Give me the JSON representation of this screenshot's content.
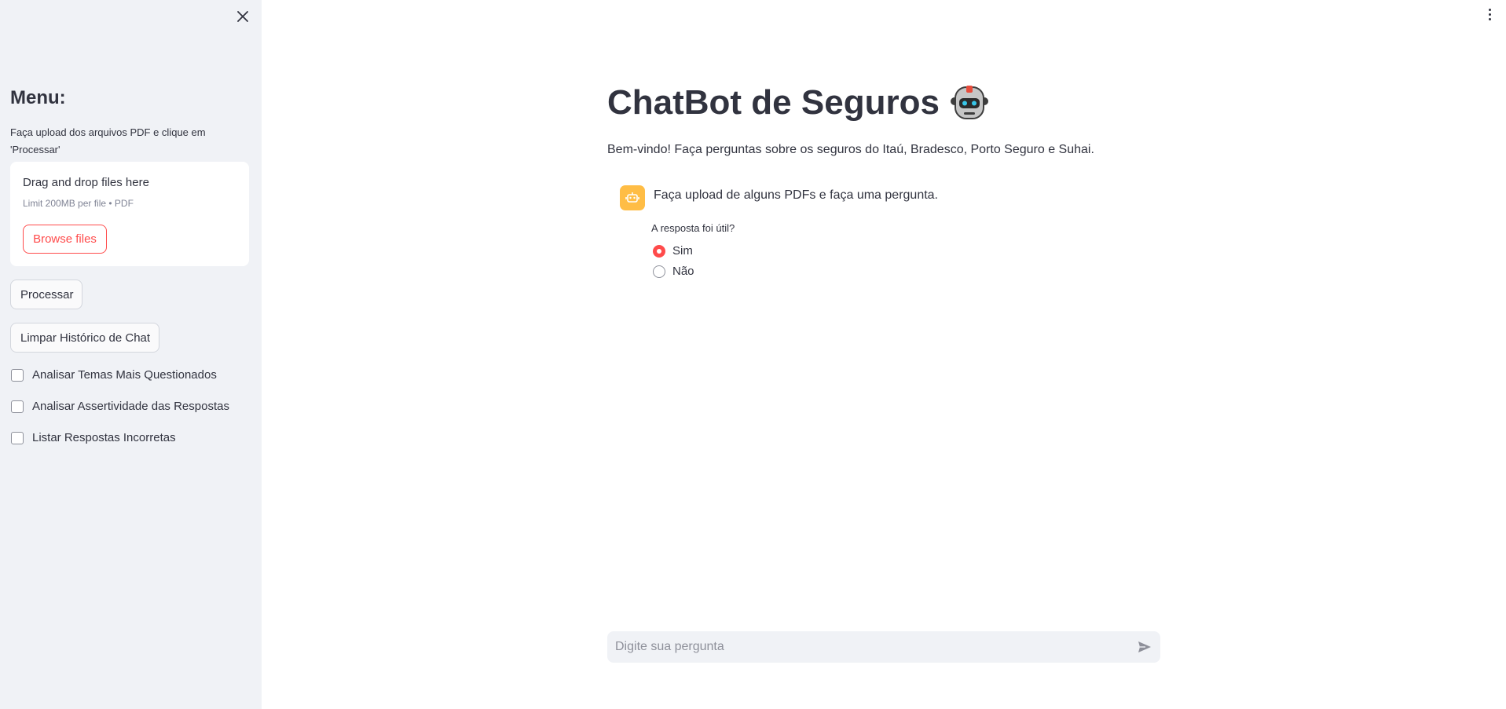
{
  "sidebar": {
    "title": "Menu:",
    "instructions": "Faça upload dos arquivos PDF e clique em 'Processar'",
    "uploader": {
      "title": "Drag and drop files here",
      "limit": "Limit 200MB per file • PDF",
      "browse_label": "Browse files"
    },
    "process_label": "Processar",
    "clear_label": "Limpar Histórico de Chat",
    "checkboxes": [
      {
        "label": "Analisar Temas Mais Questionados",
        "checked": false
      },
      {
        "label": "Analisar Assertividade das Respostas",
        "checked": false
      },
      {
        "label": "Listar Respostas Incorretas",
        "checked": false
      }
    ]
  },
  "main": {
    "title": "ChatBot de Seguros",
    "title_icon": "robot-emoji",
    "welcome": "Bem-vindo! Faça perguntas sobre os seguros do Itaú, Bradesco, Porto Seguro e Suhai.",
    "message": {
      "avatar_icon": "robot-icon",
      "text": "Faça upload de alguns PDFs e faça uma pergunta."
    },
    "feedback": {
      "label": "A resposta foi útil?",
      "options": [
        "Sim",
        "Não"
      ],
      "selected": "Sim"
    },
    "input": {
      "placeholder": "Digite sua pergunta",
      "value": ""
    }
  },
  "colors": {
    "accent": "#ff4b4b",
    "sidebar_bg": "#f0f2f6",
    "avatar_bg": "#ffbd45",
    "text": "#31333f"
  }
}
